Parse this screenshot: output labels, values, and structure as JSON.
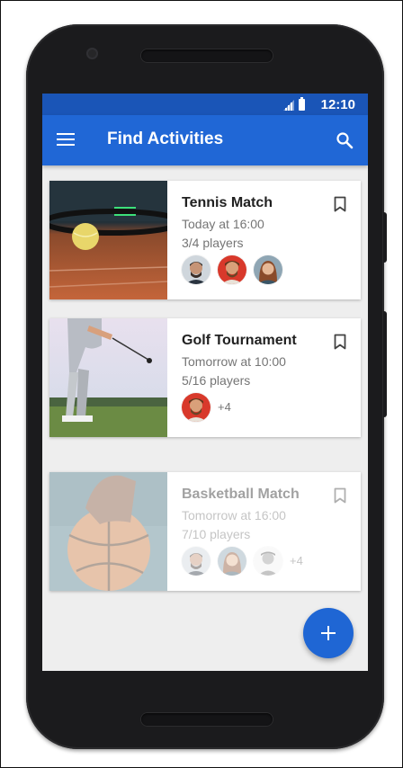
{
  "status": {
    "time": "12:10"
  },
  "appbar": {
    "title": "Find Activities"
  },
  "cards": [
    {
      "title": "Tennis Match",
      "time": "Today at 16:00",
      "players": "3/4 players",
      "extra": ""
    },
    {
      "title": "Golf Tournament",
      "time": "Tomorrow at 10:00",
      "players": "5/16 players",
      "extra": "+4"
    },
    {
      "title": "Basketball Match",
      "time": "Tomorrow at 16:00",
      "players": "7/10 players",
      "extra": "+4"
    }
  ],
  "colors": {
    "primary": "#2067d6",
    "status_bar": "#1a55b7",
    "fab": "#1f66d4"
  },
  "icons": {
    "menu": "menu-icon",
    "search": "search-icon",
    "bookmark": "bookmark-icon",
    "fab": "add-icon"
  }
}
